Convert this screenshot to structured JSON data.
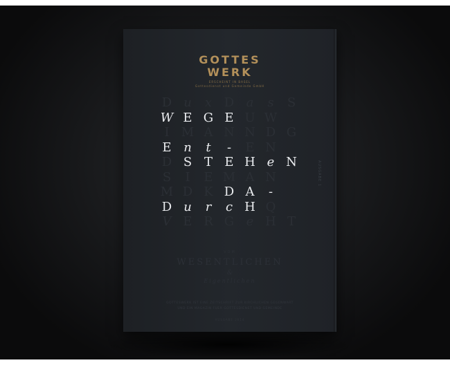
{
  "brand": {
    "line1": "GOTTES",
    "line2": "WERK",
    "sub1": "ERSCHEINT IN BASEL",
    "sub2": "Gottesdienst und Gemeinde GmbH"
  },
  "grid_rows": [
    [
      {
        "c": "D",
        "s": "dim"
      },
      {
        "c": "u",
        "s": "dim it"
      },
      {
        "c": "x",
        "s": "dim it"
      },
      {
        "c": "D",
        "s": "dim"
      },
      {
        "c": "a",
        "s": "dim it"
      },
      {
        "c": "s",
        "s": "dim it"
      },
      {
        "c": "S",
        "s": "dim"
      }
    ],
    [
      {
        "c": "W",
        "s": "lit it"
      },
      {
        "c": "E",
        "s": "lit"
      },
      {
        "c": "G",
        "s": "lit"
      },
      {
        "c": "E",
        "s": "lit"
      },
      {
        "c": "U",
        "s": "dim"
      },
      {
        "c": "W",
        "s": "dim"
      },
      {
        "c": "",
        "s": "dim"
      }
    ],
    [
      {
        "c": "I",
        "s": "dim"
      },
      {
        "c": "M",
        "s": "dim"
      },
      {
        "c": "A",
        "s": "dim"
      },
      {
        "c": "N",
        "s": "dim"
      },
      {
        "c": "N",
        "s": "dim"
      },
      {
        "c": "D",
        "s": "dim"
      },
      {
        "c": "G",
        "s": "dim"
      }
    ],
    [
      {
        "c": "E",
        "s": "lit"
      },
      {
        "c": "n",
        "s": "lit it"
      },
      {
        "c": "t",
        "s": "lit it"
      },
      {
        "c": "-",
        "s": "lit"
      },
      {
        "c": "E",
        "s": "dim"
      },
      {
        "c": "N",
        "s": "dim"
      },
      {
        "c": "",
        "s": "dim"
      }
    ],
    [
      {
        "c": "D",
        "s": "dim"
      },
      {
        "c": "S",
        "s": "lit"
      },
      {
        "c": "T",
        "s": "lit"
      },
      {
        "c": "E",
        "s": "lit"
      },
      {
        "c": "H",
        "s": "lit"
      },
      {
        "c": "e",
        "s": "lit it"
      },
      {
        "c": "N",
        "s": "lit"
      }
    ],
    [
      {
        "c": "S",
        "s": "dim"
      },
      {
        "c": "I",
        "s": "dim"
      },
      {
        "c": "E",
        "s": "dim"
      },
      {
        "c": "M",
        "s": "dim"
      },
      {
        "c": "A",
        "s": "dim"
      },
      {
        "c": "N",
        "s": "dim"
      },
      {
        "c": "",
        "s": "dim"
      }
    ],
    [
      {
        "c": "M",
        "s": "dim"
      },
      {
        "c": "D",
        "s": "dim"
      },
      {
        "c": "K",
        "s": "dim"
      },
      {
        "c": "D",
        "s": "lit"
      },
      {
        "c": "A",
        "s": "lit"
      },
      {
        "c": "-",
        "s": "lit"
      },
      {
        "c": "",
        "s": "dim"
      }
    ],
    [
      {
        "c": "D",
        "s": "lit"
      },
      {
        "c": "u",
        "s": "lit it"
      },
      {
        "c": "r",
        "s": "lit it"
      },
      {
        "c": "c",
        "s": "lit it"
      },
      {
        "c": "H",
        "s": "lit"
      },
      {
        "c": "Q",
        "s": "dim"
      },
      {
        "c": "",
        "s": "dim"
      }
    ],
    [
      {
        "c": "V",
        "s": "dim it"
      },
      {
        "c": "E",
        "s": "dim"
      },
      {
        "c": "R",
        "s": "dim"
      },
      {
        "c": "G",
        "s": "dim"
      },
      {
        "c": "e",
        "s": "dim it"
      },
      {
        "c": "H",
        "s": "dim"
      },
      {
        "c": "T",
        "s": "dim"
      }
    ]
  ],
  "side": "AUSGABE 1",
  "vom": "VOM",
  "headline": "WESENTLICHEN",
  "amp": "&",
  "eig": "Eigentlichen",
  "body1": "GOTTESWERK IST EINE ZEITSCHRIFT ZUR KIRCHLICHEN GEGENWART",
  "body2": "UND EIN MAGAZIN FUER GOTTESDIENST UND GEMEINDE",
  "foot": "AUSGABE 2014"
}
